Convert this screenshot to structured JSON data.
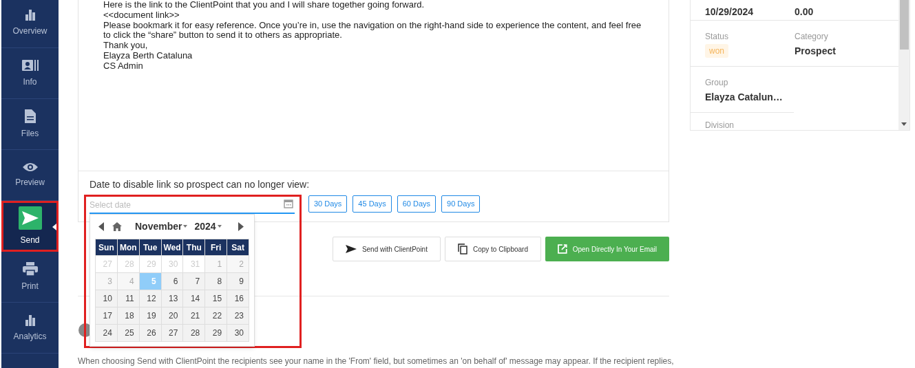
{
  "sidebar": {
    "items": [
      {
        "label": "Overview",
        "selected": false,
        "highlighted": false
      },
      {
        "label": "Info",
        "selected": false,
        "highlighted": false
      },
      {
        "label": "Files",
        "selected": false,
        "highlighted": false
      },
      {
        "label": "Preview",
        "selected": false,
        "highlighted": false
      },
      {
        "label": "Send",
        "selected": true,
        "highlighted": true
      },
      {
        "label": "Print",
        "selected": false,
        "highlighted": false
      },
      {
        "label": "Analytics",
        "selected": false,
        "highlighted": false
      }
    ]
  },
  "message": {
    "lines": [
      "Here is the link to the ClientPoint that you and I will share together going forward.",
      "<<document link>>",
      "Please bookmark it for easy reference. Once you’re in, use the navigation on the right-hand side to experience the content, and feel free",
      "to click the “share” button to send it to others as appropriate.",
      "Thank you,",
      "Elayza Berth Cataluna",
      "CS Admin"
    ]
  },
  "disable_date": {
    "label": "Date to disable link so prospect can no longer view:",
    "placeholder": "Select date",
    "highlighted": true,
    "presets": [
      "30 Days",
      "45 Days",
      "60 Days",
      "90 Days"
    ]
  },
  "calendar": {
    "month": "November",
    "year": "2024",
    "weekdays": [
      "Sun",
      "Mon",
      "Tue",
      "Wed",
      "Thu",
      "Fri",
      "Sat"
    ],
    "days": [
      {
        "label": "27",
        "outside": true,
        "disabled": true,
        "selected": false
      },
      {
        "label": "28",
        "outside": true,
        "disabled": true,
        "selected": false
      },
      {
        "label": "29",
        "outside": true,
        "disabled": true,
        "selected": false
      },
      {
        "label": "30",
        "outside": true,
        "disabled": true,
        "selected": false
      },
      {
        "label": "31",
        "outside": true,
        "disabled": true,
        "selected": false
      },
      {
        "label": "1",
        "outside": false,
        "disabled": true,
        "selected": false
      },
      {
        "label": "2",
        "outside": false,
        "disabled": true,
        "selected": false
      },
      {
        "label": "3",
        "outside": false,
        "disabled": true,
        "selected": false
      },
      {
        "label": "4",
        "outside": false,
        "disabled": true,
        "selected": false
      },
      {
        "label": "5",
        "outside": false,
        "disabled": false,
        "selected": true
      },
      {
        "label": "6",
        "outside": false,
        "disabled": false,
        "selected": false
      },
      {
        "label": "7",
        "outside": false,
        "disabled": false,
        "selected": false
      },
      {
        "label": "8",
        "outside": false,
        "disabled": false,
        "selected": false
      },
      {
        "label": "9",
        "outside": false,
        "disabled": false,
        "selected": false
      },
      {
        "label": "10",
        "outside": false,
        "disabled": false,
        "selected": false
      },
      {
        "label": "11",
        "outside": false,
        "disabled": false,
        "selected": false
      },
      {
        "label": "12",
        "outside": false,
        "disabled": false,
        "selected": false
      },
      {
        "label": "13",
        "outside": false,
        "disabled": false,
        "selected": false
      },
      {
        "label": "14",
        "outside": false,
        "disabled": false,
        "selected": false
      },
      {
        "label": "15",
        "outside": false,
        "disabled": false,
        "selected": false
      },
      {
        "label": "16",
        "outside": false,
        "disabled": false,
        "selected": false
      },
      {
        "label": "17",
        "outside": false,
        "disabled": false,
        "selected": false
      },
      {
        "label": "18",
        "outside": false,
        "disabled": false,
        "selected": false
      },
      {
        "label": "19",
        "outside": false,
        "disabled": false,
        "selected": false
      },
      {
        "label": "20",
        "outside": false,
        "disabled": false,
        "selected": false
      },
      {
        "label": "21",
        "outside": false,
        "disabled": false,
        "selected": false
      },
      {
        "label": "22",
        "outside": false,
        "disabled": false,
        "selected": false
      },
      {
        "label": "23",
        "outside": false,
        "disabled": false,
        "selected": false
      },
      {
        "label": "24",
        "outside": false,
        "disabled": false,
        "selected": false
      },
      {
        "label": "25",
        "outside": false,
        "disabled": false,
        "selected": false
      },
      {
        "label": "26",
        "outside": false,
        "disabled": false,
        "selected": false
      },
      {
        "label": "27",
        "outside": false,
        "disabled": false,
        "selected": false
      },
      {
        "label": "28",
        "outside": false,
        "disabled": false,
        "selected": false
      },
      {
        "label": "29",
        "outside": false,
        "disabled": false,
        "selected": false
      },
      {
        "label": "30",
        "outside": false,
        "disabled": false,
        "selected": false
      }
    ]
  },
  "actions": [
    {
      "label": "Send with ClientPoint",
      "kind": "send"
    },
    {
      "label": "Copy to Clipboard",
      "kind": "copy"
    },
    {
      "label": "Open Directly In Your Email",
      "kind": "email"
    }
  ],
  "note": "When choosing Send with ClientPoint the recipients see your name in the 'From' field, but sometimes an 'on behalf of' message may appear. If the recipient replies,",
  "details": {
    "rows": [
      [
        {
          "value": "10/29/2024"
        },
        {
          "value": "0.00"
        }
      ],
      [
        {
          "label": "Status",
          "value": "won",
          "kind": "badge"
        },
        {
          "label": "Category",
          "value": "Prospect"
        }
      ],
      [
        {
          "label": "Group",
          "value": "Elayza Catalun…"
        }
      ],
      [
        {
          "label": "Division"
        }
      ]
    ]
  }
}
